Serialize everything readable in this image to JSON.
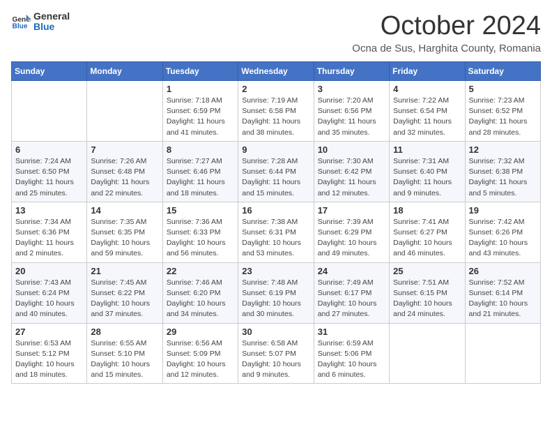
{
  "header": {
    "logo_general": "General",
    "logo_blue": "Blue",
    "month_title": "October 2024",
    "location": "Ocna de Sus, Harghita County, Romania"
  },
  "days_of_week": [
    "Sunday",
    "Monday",
    "Tuesday",
    "Wednesday",
    "Thursday",
    "Friday",
    "Saturday"
  ],
  "weeks": [
    [
      {
        "day": "",
        "detail": ""
      },
      {
        "day": "",
        "detail": ""
      },
      {
        "day": "1",
        "detail": "Sunrise: 7:18 AM\nSunset: 6:59 PM\nDaylight: 11 hours and 41 minutes."
      },
      {
        "day": "2",
        "detail": "Sunrise: 7:19 AM\nSunset: 6:58 PM\nDaylight: 11 hours and 38 minutes."
      },
      {
        "day": "3",
        "detail": "Sunrise: 7:20 AM\nSunset: 6:56 PM\nDaylight: 11 hours and 35 minutes."
      },
      {
        "day": "4",
        "detail": "Sunrise: 7:22 AM\nSunset: 6:54 PM\nDaylight: 11 hours and 32 minutes."
      },
      {
        "day": "5",
        "detail": "Sunrise: 7:23 AM\nSunset: 6:52 PM\nDaylight: 11 hours and 28 minutes."
      }
    ],
    [
      {
        "day": "6",
        "detail": "Sunrise: 7:24 AM\nSunset: 6:50 PM\nDaylight: 11 hours and 25 minutes."
      },
      {
        "day": "7",
        "detail": "Sunrise: 7:26 AM\nSunset: 6:48 PM\nDaylight: 11 hours and 22 minutes."
      },
      {
        "day": "8",
        "detail": "Sunrise: 7:27 AM\nSunset: 6:46 PM\nDaylight: 11 hours and 18 minutes."
      },
      {
        "day": "9",
        "detail": "Sunrise: 7:28 AM\nSunset: 6:44 PM\nDaylight: 11 hours and 15 minutes."
      },
      {
        "day": "10",
        "detail": "Sunrise: 7:30 AM\nSunset: 6:42 PM\nDaylight: 11 hours and 12 minutes."
      },
      {
        "day": "11",
        "detail": "Sunrise: 7:31 AM\nSunset: 6:40 PM\nDaylight: 11 hours and 9 minutes."
      },
      {
        "day": "12",
        "detail": "Sunrise: 7:32 AM\nSunset: 6:38 PM\nDaylight: 11 hours and 5 minutes."
      }
    ],
    [
      {
        "day": "13",
        "detail": "Sunrise: 7:34 AM\nSunset: 6:36 PM\nDaylight: 11 hours and 2 minutes."
      },
      {
        "day": "14",
        "detail": "Sunrise: 7:35 AM\nSunset: 6:35 PM\nDaylight: 10 hours and 59 minutes."
      },
      {
        "day": "15",
        "detail": "Sunrise: 7:36 AM\nSunset: 6:33 PM\nDaylight: 10 hours and 56 minutes."
      },
      {
        "day": "16",
        "detail": "Sunrise: 7:38 AM\nSunset: 6:31 PM\nDaylight: 10 hours and 53 minutes."
      },
      {
        "day": "17",
        "detail": "Sunrise: 7:39 AM\nSunset: 6:29 PM\nDaylight: 10 hours and 49 minutes."
      },
      {
        "day": "18",
        "detail": "Sunrise: 7:41 AM\nSunset: 6:27 PM\nDaylight: 10 hours and 46 minutes."
      },
      {
        "day": "19",
        "detail": "Sunrise: 7:42 AM\nSunset: 6:26 PM\nDaylight: 10 hours and 43 minutes."
      }
    ],
    [
      {
        "day": "20",
        "detail": "Sunrise: 7:43 AM\nSunset: 6:24 PM\nDaylight: 10 hours and 40 minutes."
      },
      {
        "day": "21",
        "detail": "Sunrise: 7:45 AM\nSunset: 6:22 PM\nDaylight: 10 hours and 37 minutes."
      },
      {
        "day": "22",
        "detail": "Sunrise: 7:46 AM\nSunset: 6:20 PM\nDaylight: 10 hours and 34 minutes."
      },
      {
        "day": "23",
        "detail": "Sunrise: 7:48 AM\nSunset: 6:19 PM\nDaylight: 10 hours and 30 minutes."
      },
      {
        "day": "24",
        "detail": "Sunrise: 7:49 AM\nSunset: 6:17 PM\nDaylight: 10 hours and 27 minutes."
      },
      {
        "day": "25",
        "detail": "Sunrise: 7:51 AM\nSunset: 6:15 PM\nDaylight: 10 hours and 24 minutes."
      },
      {
        "day": "26",
        "detail": "Sunrise: 7:52 AM\nSunset: 6:14 PM\nDaylight: 10 hours and 21 minutes."
      }
    ],
    [
      {
        "day": "27",
        "detail": "Sunrise: 6:53 AM\nSunset: 5:12 PM\nDaylight: 10 hours and 18 minutes."
      },
      {
        "day": "28",
        "detail": "Sunrise: 6:55 AM\nSunset: 5:10 PM\nDaylight: 10 hours and 15 minutes."
      },
      {
        "day": "29",
        "detail": "Sunrise: 6:56 AM\nSunset: 5:09 PM\nDaylight: 10 hours and 12 minutes."
      },
      {
        "day": "30",
        "detail": "Sunrise: 6:58 AM\nSunset: 5:07 PM\nDaylight: 10 hours and 9 minutes."
      },
      {
        "day": "31",
        "detail": "Sunrise: 6:59 AM\nSunset: 5:06 PM\nDaylight: 10 hours and 6 minutes."
      },
      {
        "day": "",
        "detail": ""
      },
      {
        "day": "",
        "detail": ""
      }
    ]
  ]
}
